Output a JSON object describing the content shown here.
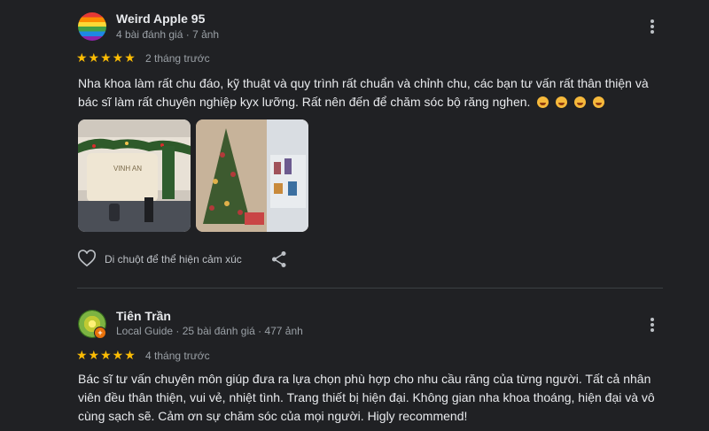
{
  "reviews": [
    {
      "author": "Weird Apple 95",
      "meta": "4 bài đánh giá · 7 ảnh",
      "stars": "★★★★★",
      "time": "2 tháng trước",
      "text": "Nha khoa làm rất chu đáo, kỹ thuật và quy trình rất chuẩn và chỉnh chu, các bạn tư vấn rất thân thiện và bác sĩ làm rất chuyên nghiệp kyx lưỡng. Rất nên đến để chăm sóc bộ răng nghen.",
      "photo_sign": "VINH AN",
      "reaction_label": "Di chuột để thể hiện cảm xúc"
    },
    {
      "author": "Tiên Trần",
      "meta": "Local Guide · 25 bài đánh giá · 477 ảnh",
      "stars": "★★★★★",
      "time": "4 tháng trước",
      "text": "Bác sĩ tư vấn chuyên môn giúp đưa ra lựa chọn phù hợp cho nhu cầu răng của từng người. Tất cả nhân viên đều thân thiện, vui vẻ, nhiệt tình. Trang thiết bị hiện đại. Không gian nha khoa thoáng, hiện đại và vô cùng sạch sẽ. Cảm ơn sự chăm sóc của mọi người. Higly recommend!"
    }
  ],
  "icons": {
    "more": "more-vert-icon",
    "heart": "heart-outline-icon",
    "share": "share-icon",
    "emoji": "smiling-face-with-heart-eyes-icon"
  },
  "colors": {
    "background": "#202124",
    "star": "#fbbc04",
    "text": "#e8eaed",
    "secondary": "#9aa0a6",
    "local_guide_badge": "#e8710a"
  }
}
